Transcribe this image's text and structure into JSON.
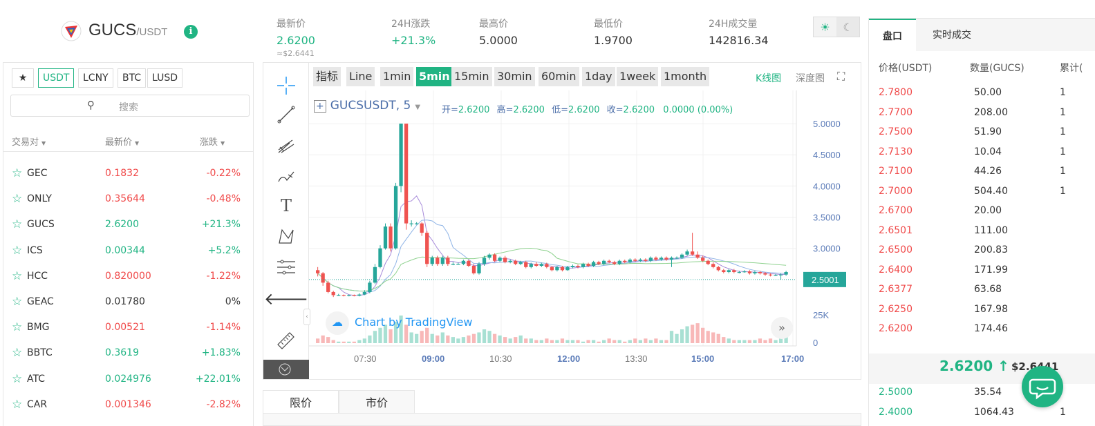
{
  "header": {
    "base": "GUCS",
    "quote": "/USDT",
    "info_icon": "i",
    "stats": [
      {
        "label": "最新价",
        "value": "2.6200",
        "color": "green"
      },
      {
        "label": "24H涨跌",
        "value": "+21.3%",
        "color": "green"
      },
      {
        "label": "最高价",
        "value": "5.0000",
        "color": "dark"
      },
      {
        "label": "最低价",
        "value": "1.9700",
        "color": "dark"
      },
      {
        "label": "24H成交量",
        "value": "142816.34",
        "color": "dark"
      }
    ],
    "usd_value": "≈$2.6441",
    "theme_light_icon": "sun-icon",
    "theme_dark_icon": "moon-icon"
  },
  "market": {
    "tabs": [
      "★",
      "USDT",
      "LCNY",
      "BTC",
      "LUSD"
    ],
    "active_tab": "USDT",
    "search_placeholder": "搜索",
    "columns": [
      "交易对",
      "最新价",
      "涨跌"
    ],
    "rows": [
      {
        "symbol": "GEC",
        "price": "0.1832",
        "change": "-0.22%",
        "dir": "down"
      },
      {
        "symbol": "ONLY",
        "price": "0.35644",
        "change": "-0.48%",
        "dir": "down"
      },
      {
        "symbol": "GUCS",
        "price": "2.6200",
        "change": "+21.3%",
        "dir": "up"
      },
      {
        "symbol": "ICS",
        "price": "0.00344",
        "change": "+5.2%",
        "dir": "up"
      },
      {
        "symbol": "HCC",
        "price": "0.820000",
        "change": "-1.22%",
        "dir": "down"
      },
      {
        "symbol": "GEAC",
        "price": "0.01780",
        "change": "0%",
        "dir": "flat"
      },
      {
        "symbol": "BMG",
        "price": "0.00521",
        "change": "-1.14%",
        "dir": "down"
      },
      {
        "symbol": "BBTC",
        "price": "0.3619",
        "change": "+1.83%",
        "dir": "up"
      },
      {
        "symbol": "ATC",
        "price": "0.024976",
        "change": "+22.01%",
        "dir": "up"
      },
      {
        "symbol": "CAR",
        "price": "0.001346",
        "change": "-2.82%",
        "dir": "down"
      }
    ]
  },
  "chart": {
    "timeframes": [
      "指标",
      "Line",
      "1min",
      "5min",
      "15min",
      "30min",
      "60min",
      "1day",
      "1week",
      "1month"
    ],
    "active_timeframe": "5min",
    "kline_link": "K线图",
    "depth_link": "深度图",
    "symbol_label": "GUCSUSDT, 5",
    "ohlc": {
      "open_label": "开=",
      "open": "2.6200",
      "high_label": "高=",
      "high": "2.6200",
      "low_label": "低=",
      "low": "2.6200",
      "close_label": "收=",
      "close": "2.6200",
      "change": "0.0000 (0.00%)"
    },
    "price_ticks": [
      "5.0000",
      "4.5000",
      "4.0000",
      "3.5000",
      "3.0000"
    ],
    "current_price_tag": "2.5001",
    "volume_ticks": [
      "25K",
      "0"
    ],
    "time_ticks": [
      "07:30",
      "09:00",
      "10:30",
      "12:00",
      "13:30",
      "15:00",
      "17:00"
    ],
    "watermark": "Chart by TradingView",
    "up_color": "#26a69a",
    "down_color": "#ef5350"
  },
  "chart_data": {
    "type": "candlestick",
    "title": "GUCSUSDT, 5",
    "ylim": [
      2.1,
      5.2
    ],
    "candles": [
      [
        2.65,
        2.6,
        2.7,
        2.55
      ],
      [
        2.6,
        2.45,
        2.62,
        2.4
      ],
      [
        2.45,
        2.3,
        2.48,
        2.28
      ],
      [
        2.3,
        2.25,
        2.32,
        2.22
      ],
      [
        2.25,
        2.25,
        2.27,
        2.24
      ],
      [
        2.25,
        2.24,
        2.26,
        2.23
      ],
      [
        2.24,
        2.25,
        2.26,
        2.23
      ],
      [
        2.25,
        2.24,
        2.26,
        2.23
      ],
      [
        2.24,
        2.26,
        2.28,
        2.23
      ],
      [
        2.26,
        2.3,
        2.33,
        2.25
      ],
      [
        2.3,
        2.45,
        2.48,
        2.28
      ],
      [
        2.45,
        2.7,
        2.75,
        2.43
      ],
      [
        2.7,
        3.0,
        3.05,
        2.68
      ],
      [
        3.0,
        3.35,
        3.4,
        2.98
      ],
      [
        3.35,
        3.0,
        3.4,
        2.95
      ],
      [
        3.0,
        4.0,
        4.05,
        2.98
      ],
      [
        4.0,
        5.0,
        5.0,
        3.9
      ],
      [
        5.0,
        3.4,
        5.0,
        3.3
      ],
      [
        3.4,
        3.4,
        3.45,
        3.35
      ],
      [
        3.4,
        3.4,
        3.42,
        3.38
      ],
      [
        3.4,
        3.25,
        3.42,
        3.2
      ],
      [
        3.25,
        2.75,
        3.28,
        2.7
      ],
      [
        2.75,
        2.85,
        2.88,
        2.72
      ],
      [
        2.85,
        2.75,
        2.88,
        2.72
      ],
      [
        2.75,
        2.85,
        2.88,
        2.72
      ],
      [
        2.85,
        2.75,
        2.88,
        2.72
      ],
      [
        2.75,
        2.75,
        2.78,
        2.73
      ],
      [
        2.75,
        2.75,
        2.77,
        2.74
      ],
      [
        2.75,
        2.8,
        2.82,
        2.73
      ],
      [
        2.8,
        2.72,
        2.82,
        2.7
      ],
      [
        2.72,
        2.6,
        2.75,
        2.58
      ],
      [
        2.6,
        2.75,
        2.78,
        2.58
      ],
      [
        2.75,
        2.85,
        2.88,
        2.72
      ],
      [
        2.85,
        2.9,
        2.92,
        2.82
      ],
      [
        2.9,
        2.8,
        2.92,
        2.78
      ],
      [
        2.8,
        2.85,
        2.87,
        2.78
      ],
      [
        2.85,
        2.78,
        2.88,
        2.76
      ],
      [
        2.78,
        2.8,
        2.82,
        2.76
      ],
      [
        2.8,
        2.75,
        2.82,
        2.73
      ],
      [
        2.75,
        2.78,
        2.8,
        2.73
      ],
      [
        2.78,
        2.7,
        2.8,
        2.68
      ],
      [
        2.7,
        2.75,
        2.77,
        2.68
      ],
      [
        2.75,
        2.72,
        2.78,
        2.7
      ],
      [
        2.72,
        2.75,
        2.77,
        2.7
      ],
      [
        2.75,
        2.7,
        2.77,
        2.68
      ],
      [
        2.7,
        2.65,
        2.72,
        2.63
      ],
      [
        2.65,
        2.7,
        2.72,
        2.63
      ],
      [
        2.7,
        2.65,
        2.72,
        2.63
      ],
      [
        2.65,
        2.7,
        2.72,
        2.64
      ],
      [
        2.7,
        2.72,
        2.74,
        2.68
      ],
      [
        2.72,
        2.7,
        2.74,
        2.68
      ],
      [
        2.7,
        2.75,
        2.77,
        2.68
      ],
      [
        2.75,
        2.72,
        2.77,
        2.7
      ],
      [
        2.72,
        2.78,
        2.8,
        2.7
      ],
      [
        2.78,
        2.75,
        2.8,
        2.73
      ],
      [
        2.75,
        2.8,
        2.82,
        2.73
      ],
      [
        2.8,
        2.78,
        2.82,
        2.76
      ],
      [
        2.78,
        2.75,
        2.8,
        2.73
      ],
      [
        2.75,
        2.8,
        2.82,
        2.73
      ],
      [
        2.8,
        2.78,
        2.82,
        2.76
      ],
      [
        2.78,
        2.82,
        2.84,
        2.76
      ],
      [
        2.82,
        2.8,
        2.84,
        2.78
      ],
      [
        2.8,
        2.82,
        2.84,
        2.78
      ],
      [
        2.82,
        2.8,
        2.84,
        2.78
      ],
      [
        2.8,
        2.85,
        2.87,
        2.78
      ],
      [
        2.85,
        2.82,
        2.87,
        2.8
      ],
      [
        2.82,
        2.85,
        2.87,
        2.8
      ],
      [
        2.85,
        2.82,
        2.87,
        2.8
      ],
      [
        2.82,
        2.85,
        2.87,
        2.7
      ],
      [
        2.85,
        2.85,
        2.87,
        2.83
      ],
      [
        2.85,
        2.9,
        2.92,
        2.83
      ],
      [
        2.9,
        2.95,
        2.98,
        2.88
      ],
      [
        2.95,
        2.9,
        3.25,
        2.88
      ],
      [
        2.9,
        2.85,
        2.95,
        2.83
      ],
      [
        2.85,
        2.8,
        2.88,
        2.78
      ],
      [
        2.8,
        2.75,
        2.82,
        2.73
      ],
      [
        2.75,
        2.7,
        2.78,
        2.68
      ],
      [
        2.7,
        2.65,
        2.72,
        2.63
      ],
      [
        2.65,
        2.62,
        2.67,
        2.6
      ],
      [
        2.62,
        2.65,
        2.67,
        2.6
      ],
      [
        2.65,
        2.62,
        2.67,
        2.6
      ],
      [
        2.62,
        2.62,
        2.64,
        2.6
      ],
      [
        2.62,
        2.63,
        2.65,
        2.61
      ],
      [
        2.63,
        2.6,
        2.65,
        2.58
      ],
      [
        2.6,
        2.62,
        2.64,
        2.58
      ],
      [
        2.62,
        2.6,
        2.64,
        2.58
      ],
      [
        2.6,
        2.58,
        2.62,
        2.56
      ],
      [
        2.58,
        2.57,
        2.6,
        2.55
      ],
      [
        2.57,
        2.57,
        2.59,
        2.56
      ],
      [
        2.57,
        2.58,
        2.6,
        2.5
      ],
      [
        2.58,
        2.62,
        2.64,
        2.56
      ]
    ],
    "volumes": [
      3,
      5,
      4,
      2,
      1,
      1,
      1,
      1,
      2,
      3,
      5,
      8,
      10,
      12,
      9,
      14,
      18,
      12,
      7,
      6,
      8,
      10,
      6,
      5,
      7,
      5,
      4,
      3,
      4,
      5,
      6,
      7,
      9,
      8,
      6,
      5,
      4,
      3,
      4,
      5,
      3,
      3,
      2,
      2,
      3,
      2,
      2,
      3,
      2,
      2,
      2,
      1,
      2,
      2,
      1,
      2,
      3,
      2,
      2,
      1,
      2,
      3,
      2,
      3,
      2,
      3,
      2,
      2,
      8,
      6,
      9,
      11,
      12,
      13,
      10,
      8,
      7,
      6,
      4,
      3,
      2,
      2,
      2,
      2,
      2,
      3,
      2,
      3,
      2,
      3,
      4
    ],
    "ma_series": [
      {
        "color": "#a78bda"
      },
      {
        "color": "#8fb4e6"
      },
      {
        "color": "#8fd28f"
      }
    ]
  },
  "bottom_tabs": [
    "限价",
    "市价"
  ],
  "orderbook": {
    "tabs": [
      "盘口",
      "实时成交"
    ],
    "active_tab": "盘口",
    "headers": [
      "价格(USDT)",
      "数量(GUCS)",
      "累计("
    ],
    "asks": [
      {
        "price": "2.7800",
        "qty": "50.00",
        "cum": "1"
      },
      {
        "price": "2.7700",
        "qty": "208.00",
        "cum": "1"
      },
      {
        "price": "2.7500",
        "qty": "51.90",
        "cum": "1"
      },
      {
        "price": "2.7130",
        "qty": "10.04",
        "cum": "1"
      },
      {
        "price": "2.7100",
        "qty": "44.26",
        "cum": "1"
      },
      {
        "price": "2.7000",
        "qty": "504.40",
        "cum": "1"
      },
      {
        "price": "2.6700",
        "qty": "20.00",
        "cum": ""
      },
      {
        "price": "2.6501",
        "qty": "111.00",
        "cum": ""
      },
      {
        "price": "2.6500",
        "qty": "200.83",
        "cum": ""
      },
      {
        "price": "2.6400",
        "qty": "171.99",
        "cum": ""
      },
      {
        "price": "2.6377",
        "qty": "63.68",
        "cum": ""
      },
      {
        "price": "2.6250",
        "qty": "167.98",
        "cum": ""
      },
      {
        "price": "2.6200",
        "qty": "174.46",
        "cum": ""
      }
    ],
    "mid_price": "2.6200 ↑",
    "mid_usd": "$2.6441",
    "bids": [
      {
        "price": "2.5000",
        "qty": "35.54",
        "cum": ""
      },
      {
        "price": "2.4000",
        "qty": "1064.43",
        "cum": "1"
      }
    ]
  },
  "chat_icon": "chat-bubble-icon"
}
